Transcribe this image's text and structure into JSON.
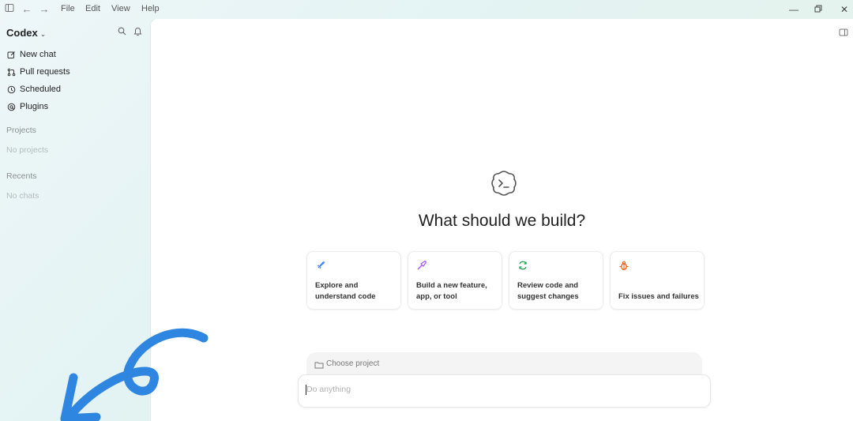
{
  "titlebar": {
    "icons": [
      "sidebar-toggle-icon",
      "arrow-left-icon",
      "arrow-right-icon"
    ],
    "menus": [
      "File",
      "Edit",
      "View",
      "Help"
    ],
    "window_controls": [
      "minimize-icon",
      "restore-icon",
      "close-icon"
    ]
  },
  "sidebar": {
    "brand": "Codex",
    "nav": [
      {
        "label": "New chat",
        "icon": "edit-icon"
      },
      {
        "label": "Pull requests",
        "icon": "pull-request-icon"
      },
      {
        "label": "Scheduled",
        "icon": "clock-icon"
      },
      {
        "label": "Plugins",
        "icon": "plugin-icon"
      }
    ],
    "projects_heading": "Projects",
    "projects_empty": "No projects",
    "recents_heading": "Recents",
    "recents_empty": "No chats"
  },
  "main": {
    "headline": "What should we build?",
    "cards": [
      {
        "label": "Explore and understand code",
        "icon": "rocket-icon",
        "color": "#3b82f6"
      },
      {
        "label": "Build a new feature, app, or tool",
        "icon": "hammer-icon",
        "color": "#a855f7"
      },
      {
        "label": "Review code and suggest changes",
        "icon": "refresh-icon",
        "color": "#16a34a"
      },
      {
        "label": "Fix issues and failures",
        "icon": "bug-icon",
        "color": "#ea580c"
      }
    ],
    "project_selector": "Choose project",
    "composer_placeholder": "Do anything"
  },
  "colors": {
    "accent_arrow": "#2f86e0"
  }
}
